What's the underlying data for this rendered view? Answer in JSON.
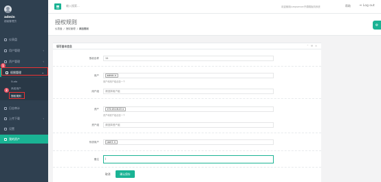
{
  "profile": {
    "name": "admin",
    "role": "超级管理员"
  },
  "sidebar": {
    "items": [
      {
        "label": "仪表盘"
      },
      {
        "label": "用户管理"
      },
      {
        "label": "资产管理"
      },
      {
        "label": "权限管理"
      },
      {
        "label": "日志审计"
      },
      {
        "label": "上传下载"
      },
      {
        "label": "设置"
      }
    ],
    "subitems": [
      {
        "label": "Sudo"
      },
      {
        "label": "系统用户"
      },
      {
        "label": "授权规则"
      }
    ],
    "bottom": {
      "label": "我的资产"
    },
    "badge_1": "1",
    "badge_2": "2"
  },
  "topbar": {
    "search_placeholder": "输入搜索...",
    "welcome": "欢迎使用Jumpserver开源跳板机系统",
    "help": "帮助",
    "logout": "Log out"
  },
  "heading": {
    "title": "授权规则",
    "breadcrumb": [
      "仪表盘",
      "授权管理",
      "添加规则"
    ]
  },
  "panel": {
    "title": "填写基本信息",
    "fields": {
      "name": {
        "label": "授权名称",
        "value": "11"
      },
      "user": {
        "label": "用户",
        "tag": "admin"
      },
      "user_help": "用户和用户组必选一个",
      "user_group": {
        "label": "用户组",
        "placeholder": "请选择用户组"
      },
      "asset": {
        "label": "资产",
        "tag": "172.20.16.15"
      },
      "asset_help": "资产和资产组必选一个",
      "asset_group": {
        "label": "资产组",
        "placeholder": "请选择资产组"
      },
      "system_user": {
        "label": "系统用户",
        "tag": "user1"
      },
      "comment": {
        "label": "备注",
        "value": "|"
      }
    },
    "cancel": "取消",
    "submit": "确认保存"
  },
  "colors": {
    "accent": "#1ab394",
    "sidebar": "#2f4050",
    "alert": "#ed5565"
  }
}
